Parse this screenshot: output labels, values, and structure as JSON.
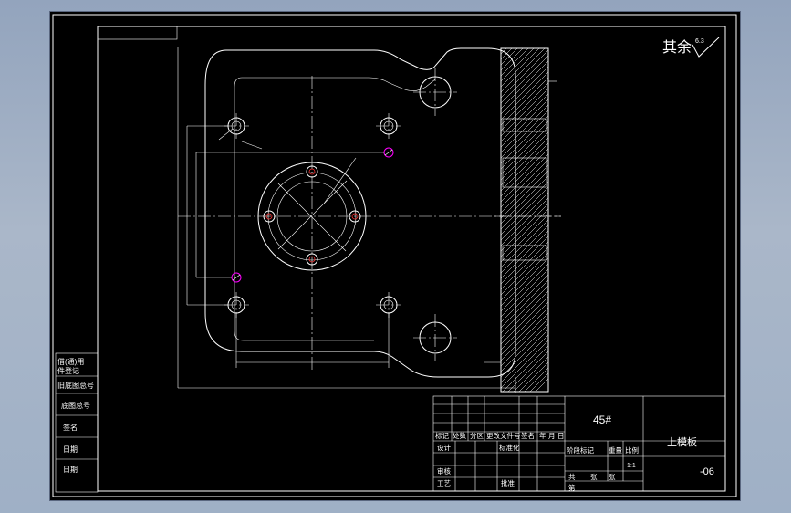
{
  "drawing": {
    "roughness_label": "其余",
    "roughness_value": "6.3",
    "material": "45#",
    "part_name": "上模板",
    "drawing_number": "-06",
    "scale_value": "1:1"
  },
  "left_strip": {
    "rows": [
      "借(通)用",
      "件登记",
      "旧底图总号",
      "底图总号",
      "签名",
      "日期",
      "日期"
    ]
  },
  "title_block": {
    "rev_headers": [
      "标记",
      "处数",
      "分区",
      "更改文件号",
      "签名",
      "年",
      "月",
      "日"
    ],
    "row_design": "设计",
    "row_std": "标准化",
    "row_check": "审核",
    "row_process": "工艺",
    "row_approve": "批准",
    "stage_headers": [
      "阶段标记",
      "重量",
      "比例"
    ],
    "sheet_labels": [
      "共",
      "张",
      "第",
      "张"
    ]
  },
  "colors": {
    "background": "#000000",
    "lines": "#ffffff",
    "accent_magenta": "#ff00ff",
    "accent_red": "#ff3030"
  }
}
